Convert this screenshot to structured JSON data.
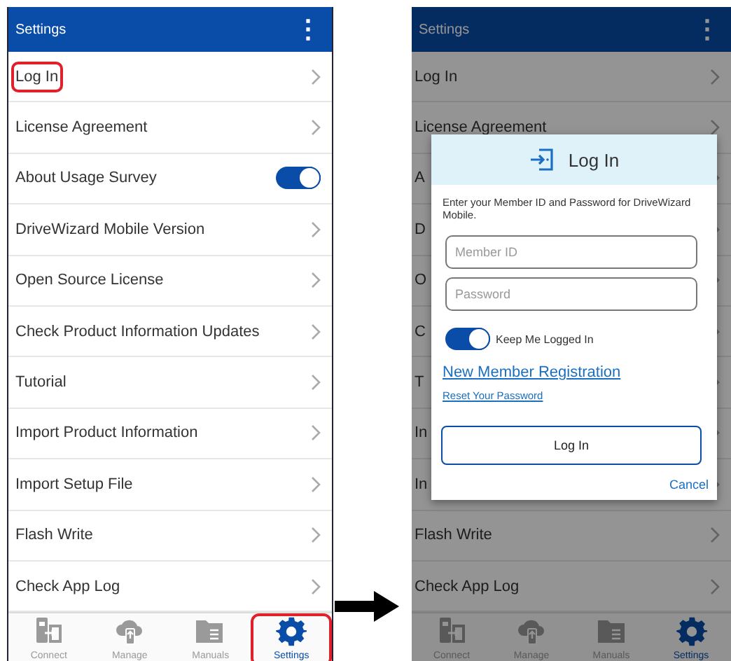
{
  "left_screen": {
    "app_bar": {
      "title": "Settings",
      "menu_icon": "⋮"
    },
    "items": [
      {
        "label": "Log In",
        "kind": "link",
        "highlighted": true
      },
      {
        "label": "License Agreement",
        "kind": "link",
        "highlighted": false
      },
      {
        "label": "About Usage Survey",
        "kind": "toggle",
        "on": true,
        "highlighted": false
      },
      {
        "label": "DriveWizard Mobile Version",
        "kind": "link",
        "highlighted": false
      },
      {
        "label": "Open Source License",
        "kind": "link",
        "highlighted": false
      },
      {
        "label": "Check Product Information Updates",
        "kind": "link",
        "highlighted": false
      },
      {
        "label": "Tutorial",
        "kind": "link",
        "highlighted": false
      },
      {
        "label": "Import Product Information",
        "kind": "link",
        "highlighted": false
      },
      {
        "label": "Import Setup File",
        "kind": "link",
        "highlighted": false
      },
      {
        "label": "Flash Write",
        "kind": "link",
        "highlighted": false
      },
      {
        "label": "Check App Log",
        "kind": "link",
        "highlighted": false
      }
    ],
    "bottom_nav": [
      {
        "label": "Connect",
        "kind": "connect",
        "selected": false,
        "highlighted": false
      },
      {
        "label": "Manage",
        "kind": "cloud",
        "selected": false,
        "highlighted": false
      },
      {
        "label": "Manuals",
        "kind": "folder",
        "selected": false,
        "highlighted": false
      },
      {
        "label": "Settings",
        "kind": "gear",
        "selected": true,
        "highlighted": true
      }
    ]
  },
  "right_screen": {
    "app_bar": {
      "title": "Settings",
      "menu_icon": "⋮"
    },
    "items": [
      {
        "label": "Log In",
        "kind": "link",
        "highlighted": false
      },
      {
        "label": "License Agreement",
        "kind": "link",
        "highlighted": false
      },
      {
        "label": "A",
        "kind": "link",
        "highlighted": false
      },
      {
        "label": "D",
        "kind": "link",
        "highlighted": false
      },
      {
        "label": "O",
        "kind": "link",
        "highlighted": false
      },
      {
        "label": "C",
        "kind": "link",
        "highlighted": false
      },
      {
        "label": "T",
        "kind": "link",
        "highlighted": false
      },
      {
        "label": "In",
        "kind": "link",
        "highlighted": false
      },
      {
        "label": "In",
        "kind": "link",
        "highlighted": false
      },
      {
        "label": "Flash Write",
        "kind": "link",
        "highlighted": false
      },
      {
        "label": "Check App Log",
        "kind": "link",
        "highlighted": false
      }
    ],
    "bottom_nav": [
      {
        "label": "Connect",
        "kind": "connect",
        "selected": false,
        "highlighted": false
      },
      {
        "label": "Manage",
        "kind": "cloud",
        "selected": false,
        "highlighted": false
      },
      {
        "label": "Manuals",
        "kind": "folder",
        "selected": false,
        "highlighted": false
      },
      {
        "label": "Settings",
        "kind": "gear",
        "selected": true,
        "highlighted": false
      }
    ],
    "dialog": {
      "title": "Log In",
      "message": "Enter your Member ID and Password for DriveWizard Mobile.",
      "fields": [
        {
          "placeholder": "Member ID"
        },
        {
          "placeholder": "Password"
        }
      ],
      "keep_logged_in": {
        "label": "Keep Me Logged In",
        "on": true
      },
      "register_link": "New Member Registration",
      "reset_link": "Reset Your Password",
      "login_button": "Log In",
      "cancel_button": "Cancel"
    }
  }
}
